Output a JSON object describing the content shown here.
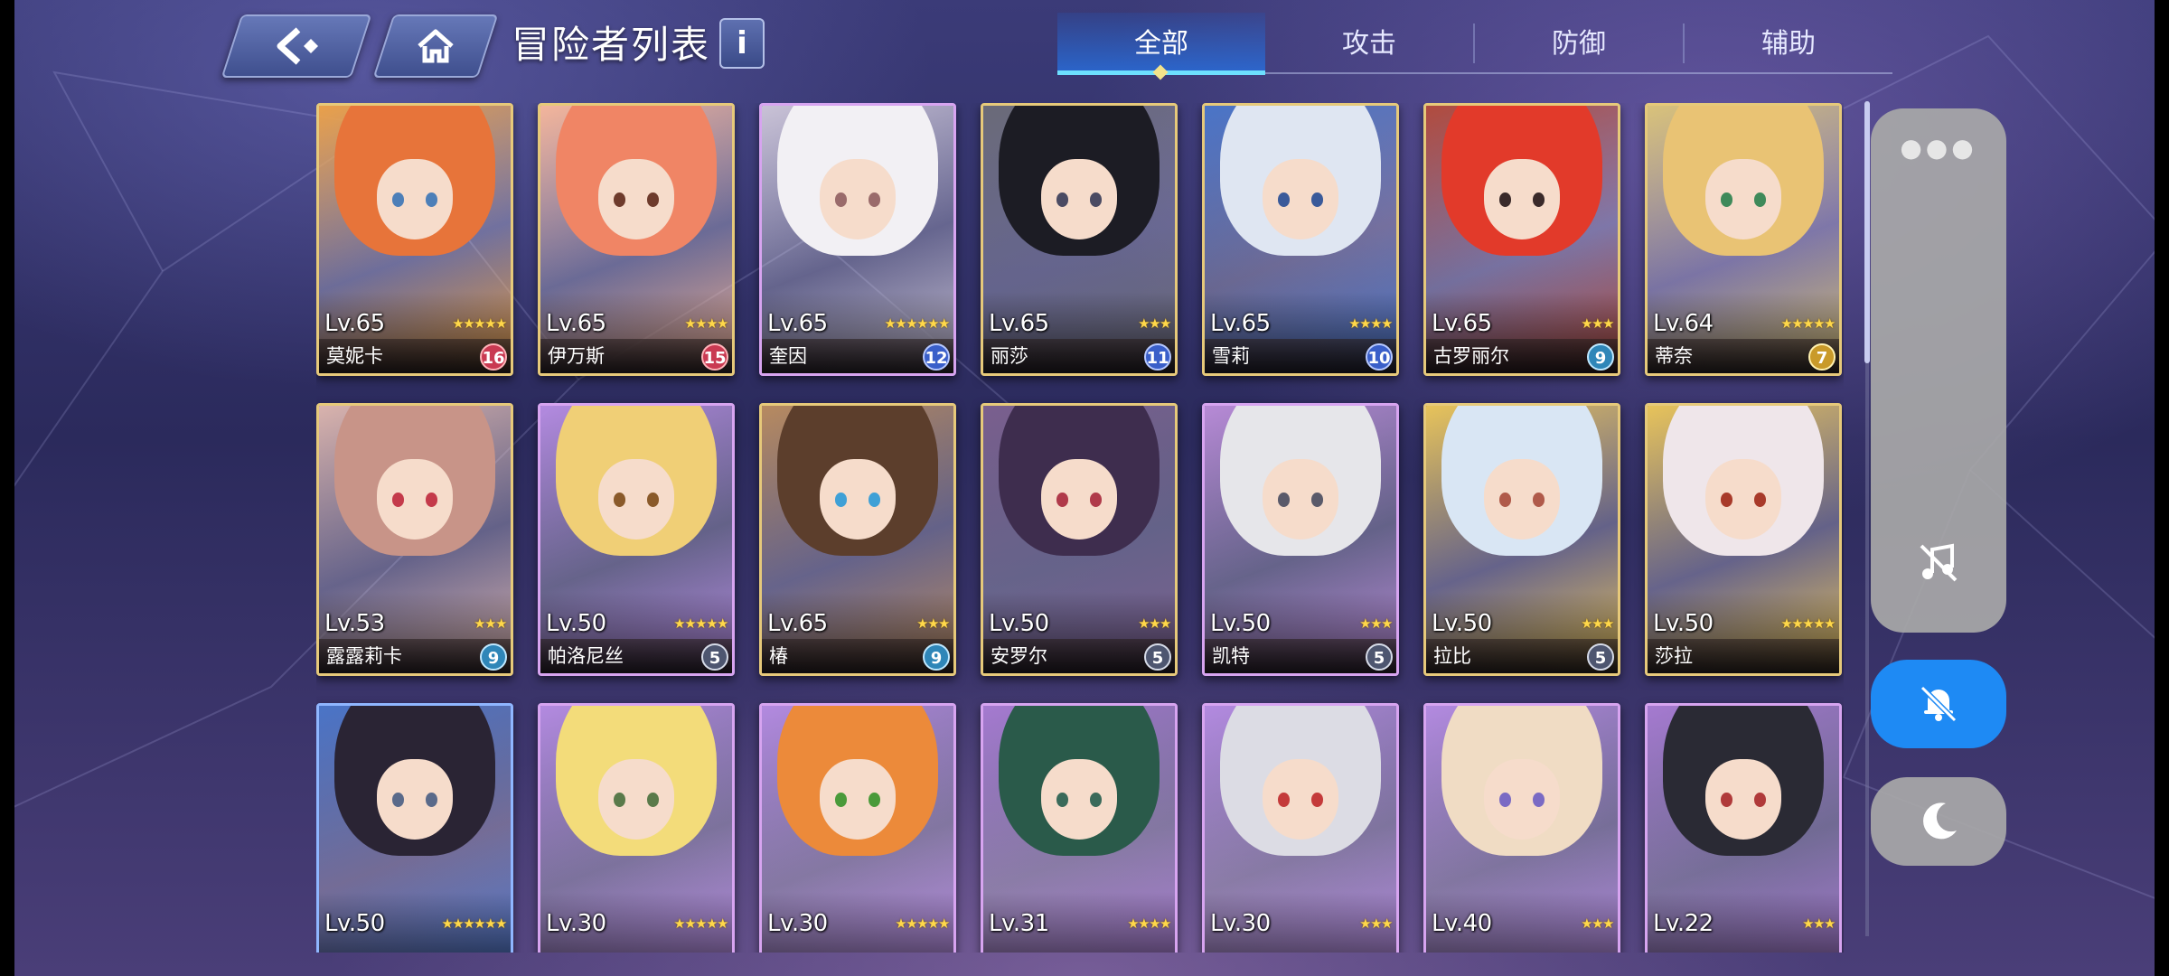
{
  "header": {
    "title": "冒险者列表",
    "back_icon": "back-arrow-icon",
    "home_icon": "home-icon",
    "info_icon": "info-icon",
    "info_label": "i"
  },
  "tabs": [
    {
      "label": "全部",
      "active": true
    },
    {
      "label": "攻击",
      "active": false
    },
    {
      "label": "防御",
      "active": false
    },
    {
      "label": "辅助",
      "active": false
    }
  ],
  "cards": [
    {
      "level": "Lv.65",
      "name": "莫妮卡",
      "stars": "★★★★★",
      "count": "16",
      "badge": "red",
      "rarity": "gold",
      "bg": "#e9a04a",
      "hair": "#e7743a",
      "eye": "#4d7fb8"
    },
    {
      "level": "Lv.65",
      "name": "伊万斯",
      "stars": "★★★★",
      "count": "15",
      "badge": "red",
      "rarity": "gold",
      "bg": "#f3b59b",
      "hair": "#f08565",
      "eye": "#6e3b2c"
    },
    {
      "level": "Lv.65",
      "name": "奎因",
      "stars": "★★★★★★",
      "count": "12",
      "badge": "blue",
      "rarity": "purple",
      "bg": "#c9c2d6",
      "hair": "#f2f0f4",
      "eye": "#9a6b6b"
    },
    {
      "level": "Lv.65",
      "name": "丽莎",
      "stars": "★★★",
      "count": "11",
      "badge": "blue",
      "rarity": "gold",
      "bg": "#6a6a78",
      "hair": "#1c1c24",
      "eye": "#4b4b63"
    },
    {
      "level": "Lv.65",
      "name": "雪莉",
      "stars": "★★★★",
      "count": "10",
      "badge": "blue",
      "rarity": "gold",
      "bg": "#4a74c7",
      "hair": "#dfe6f2",
      "eye": "#3a5a9a"
    },
    {
      "level": "Lv.65",
      "name": "古罗丽尔",
      "stars": "★★★",
      "count": "9",
      "badge": "teal",
      "rarity": "gold",
      "bg": "#b14b3e",
      "hair": "#e23a2a",
      "eye": "#3a2a2a"
    },
    {
      "level": "Lv.64",
      "name": "蒂奈",
      "stars": "★★★★★",
      "count": "7",
      "badge": "gold",
      "rarity": "gold",
      "bg": "#d9c27a",
      "hair": "#e9c374",
      "eye": "#3f8a5a"
    },
    {
      "level": "Lv.53",
      "name": "露露莉卡",
      "stars": "★★★",
      "count": "9",
      "badge": "teal",
      "rarity": "gold",
      "bg": "#d9b3ad",
      "hair": "#c89488",
      "eye": "#c43a4a"
    },
    {
      "level": "Lv.50",
      "name": "帕洛尼丝",
      "stars": "★★★★★",
      "count": "5",
      "badge": "slate",
      "rarity": "purple",
      "bg": "#b38ae0",
      "hair": "#f0cf76",
      "eye": "#8a5a2a"
    },
    {
      "level": "Lv.65",
      "name": "椿",
      "stars": "★★★",
      "count": "9",
      "badge": "teal",
      "rarity": "gold",
      "bg": "#b78a60",
      "hair": "#5c3e2c",
      "eye": "#3fa0d6"
    },
    {
      "level": "Lv.50",
      "name": "安罗尔",
      "stars": "★★★",
      "count": "5",
      "badge": "slate",
      "rarity": "gold",
      "bg": "#7a5f8e",
      "hair": "#3e2d4e",
      "eye": "#b03a4a"
    },
    {
      "level": "Lv.50",
      "name": "凯特",
      "stars": "★★★",
      "count": "5",
      "badge": "slate",
      "rarity": "purple",
      "bg": "#b78ad6",
      "hair": "#e6e6ea",
      "eye": "#5a5a6a"
    },
    {
      "level": "Lv.50",
      "name": "拉比",
      "stars": "★★★",
      "count": "5",
      "badge": "slate",
      "rarity": "gold",
      "bg": "#e7c35a",
      "hair": "#d9e6f4",
      "eye": "#b05a4a"
    },
    {
      "level": "Lv.50",
      "name": "莎拉",
      "stars": "★★★★★",
      "count": "",
      "badge": "",
      "rarity": "gold",
      "bg": "#e7c35a",
      "hair": "#efe6ea",
      "eye": "#a83a2a"
    },
    {
      "level": "Lv.50",
      "name": "",
      "stars": "★★★★★★",
      "count": "",
      "badge": "",
      "rarity": "blue",
      "bg": "#4a74c7",
      "hair": "#2a2434",
      "eye": "#5a6a8a"
    },
    {
      "level": "Lv.30",
      "name": "",
      "stars": "★★★★★",
      "count": "",
      "badge": "",
      "rarity": "purple",
      "bg": "#b38ae0",
      "hair": "#f3dc7a",
      "eye": "#5a7a4a"
    },
    {
      "level": "Lv.30",
      "name": "",
      "stars": "★★★★★",
      "count": "",
      "badge": "",
      "rarity": "purple",
      "bg": "#b38ae0",
      "hair": "#ec8a3a",
      "eye": "#4a9a3a"
    },
    {
      "level": "Lv.31",
      "name": "",
      "stars": "★★★★",
      "count": "",
      "badge": "",
      "rarity": "purple",
      "bg": "#a57ad0",
      "hair": "#2a5a4a",
      "eye": "#3a6a5a"
    },
    {
      "level": "Lv.30",
      "name": "",
      "stars": "★★★",
      "count": "",
      "badge": "",
      "rarity": "purple",
      "bg": "#b38ae0",
      "hair": "#dcdce4",
      "eye": "#c43a3a"
    },
    {
      "level": "Lv.40",
      "name": "",
      "stars": "★★★",
      "count": "",
      "badge": "",
      "rarity": "purple",
      "bg": "#b38ae0",
      "hair": "#f0dcc4",
      "eye": "#7a6ac4"
    },
    {
      "level": "Lv.22",
      "name": "",
      "stars": "★★★",
      "count": "",
      "badge": "",
      "rarity": "purple",
      "bg": "#a57ad0",
      "hair": "#2a2a34",
      "eye": "#b03a3a"
    }
  ],
  "side_panel": {
    "more_icon": "more-dots-icon",
    "music_icon": "music-off-icon",
    "mute_icon": "bell-muted-icon",
    "night_icon": "moon-icon",
    "accent": "#1e8af4"
  }
}
